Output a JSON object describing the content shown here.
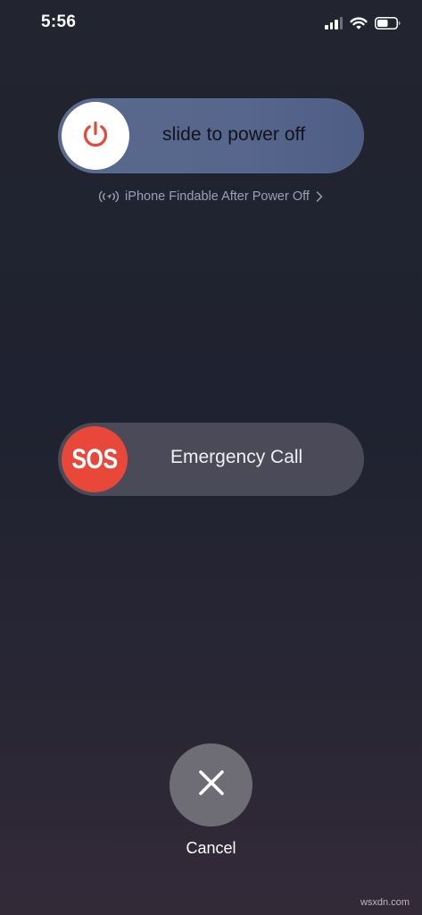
{
  "status_bar": {
    "time": "5:56",
    "icons": [
      "signal-icon",
      "wifi-icon",
      "battery-icon"
    ]
  },
  "power_slider": {
    "label": "slide to power off",
    "icon": "power-icon",
    "knob_color": "#ffffff",
    "icon_color": "#e9473a"
  },
  "findable": {
    "text": "iPhone Findable After Power Off",
    "icon": "findable-location-icon",
    "chevron": "chevron-right-icon"
  },
  "sos_slider": {
    "knob_text": "SOS",
    "label": "Emergency Call",
    "knob_color": "#e9473a"
  },
  "cancel": {
    "icon": "close-icon",
    "label": "Cancel"
  },
  "watermark": {
    "text": "wsxdn.com"
  }
}
